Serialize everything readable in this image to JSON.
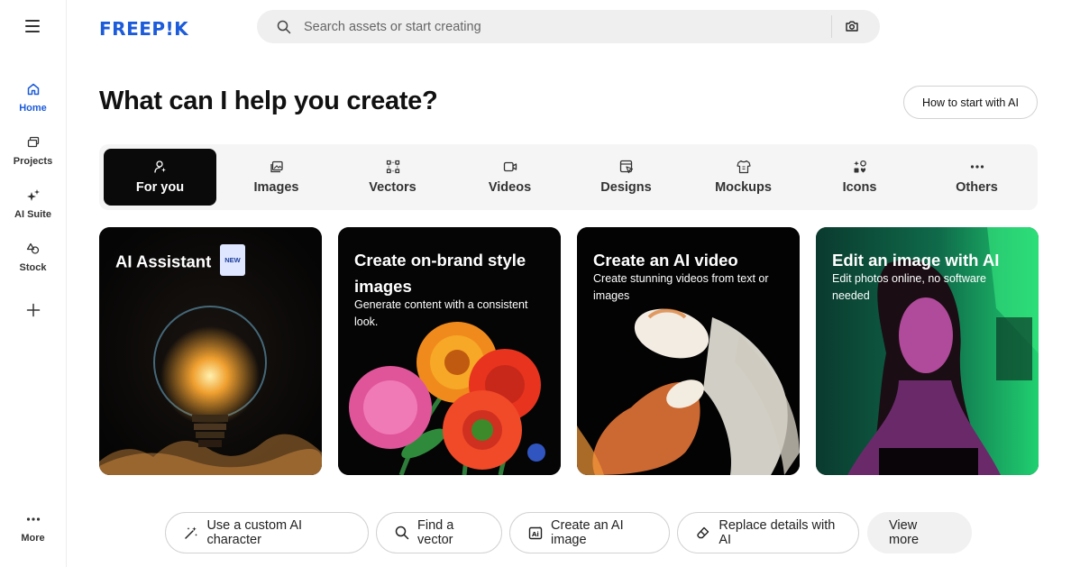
{
  "brand": {
    "logo_text": "FREEP!K",
    "accent": "#1C5BD9"
  },
  "sidebar": {
    "items": [
      {
        "label": "Home",
        "icon": "home-icon",
        "active": true
      },
      {
        "label": "Projects",
        "icon": "projects-icon"
      },
      {
        "label": "AI Suite",
        "icon": "sparkle-icon"
      },
      {
        "label": "Stock",
        "icon": "stock-icon"
      }
    ],
    "more_label": "More"
  },
  "search": {
    "placeholder": "Search assets or start creating"
  },
  "header": {
    "title": "What can I help you create?",
    "how_to_label": "How to start with AI"
  },
  "tabs": [
    {
      "label": "For you",
      "icon": "user-sparkle-icon",
      "active": true
    },
    {
      "label": "Images",
      "icon": "images-icon"
    },
    {
      "label": "Vectors",
      "icon": "vectors-icon"
    },
    {
      "label": "Videos",
      "icon": "video-icon"
    },
    {
      "label": "Designs",
      "icon": "designs-icon"
    },
    {
      "label": "Mockups",
      "icon": "mockups-icon"
    },
    {
      "label": "Icons",
      "icon": "icons-icon"
    },
    {
      "label": "Others",
      "icon": "dots-icon"
    }
  ],
  "cards": [
    {
      "title": "AI Assistant",
      "badge": "NEW",
      "subtitle": ""
    },
    {
      "title": "Create on-brand style images",
      "subtitle": "Generate content with a consistent look."
    },
    {
      "title": "Create an AI video",
      "subtitle": "Create stunning videos from text or images"
    },
    {
      "title": "Edit an image with AI",
      "subtitle": "Edit photos online, no software needed"
    }
  ],
  "quick_actions": [
    {
      "label": "Use a custom AI character",
      "icon": "magic-wand-icon"
    },
    {
      "label": "Find a vector",
      "icon": "search-icon"
    },
    {
      "label": "Create an AI image",
      "icon": "ai-image-icon"
    },
    {
      "label": "Replace details with AI",
      "icon": "eraser-icon"
    },
    {
      "label": "View more"
    }
  ]
}
